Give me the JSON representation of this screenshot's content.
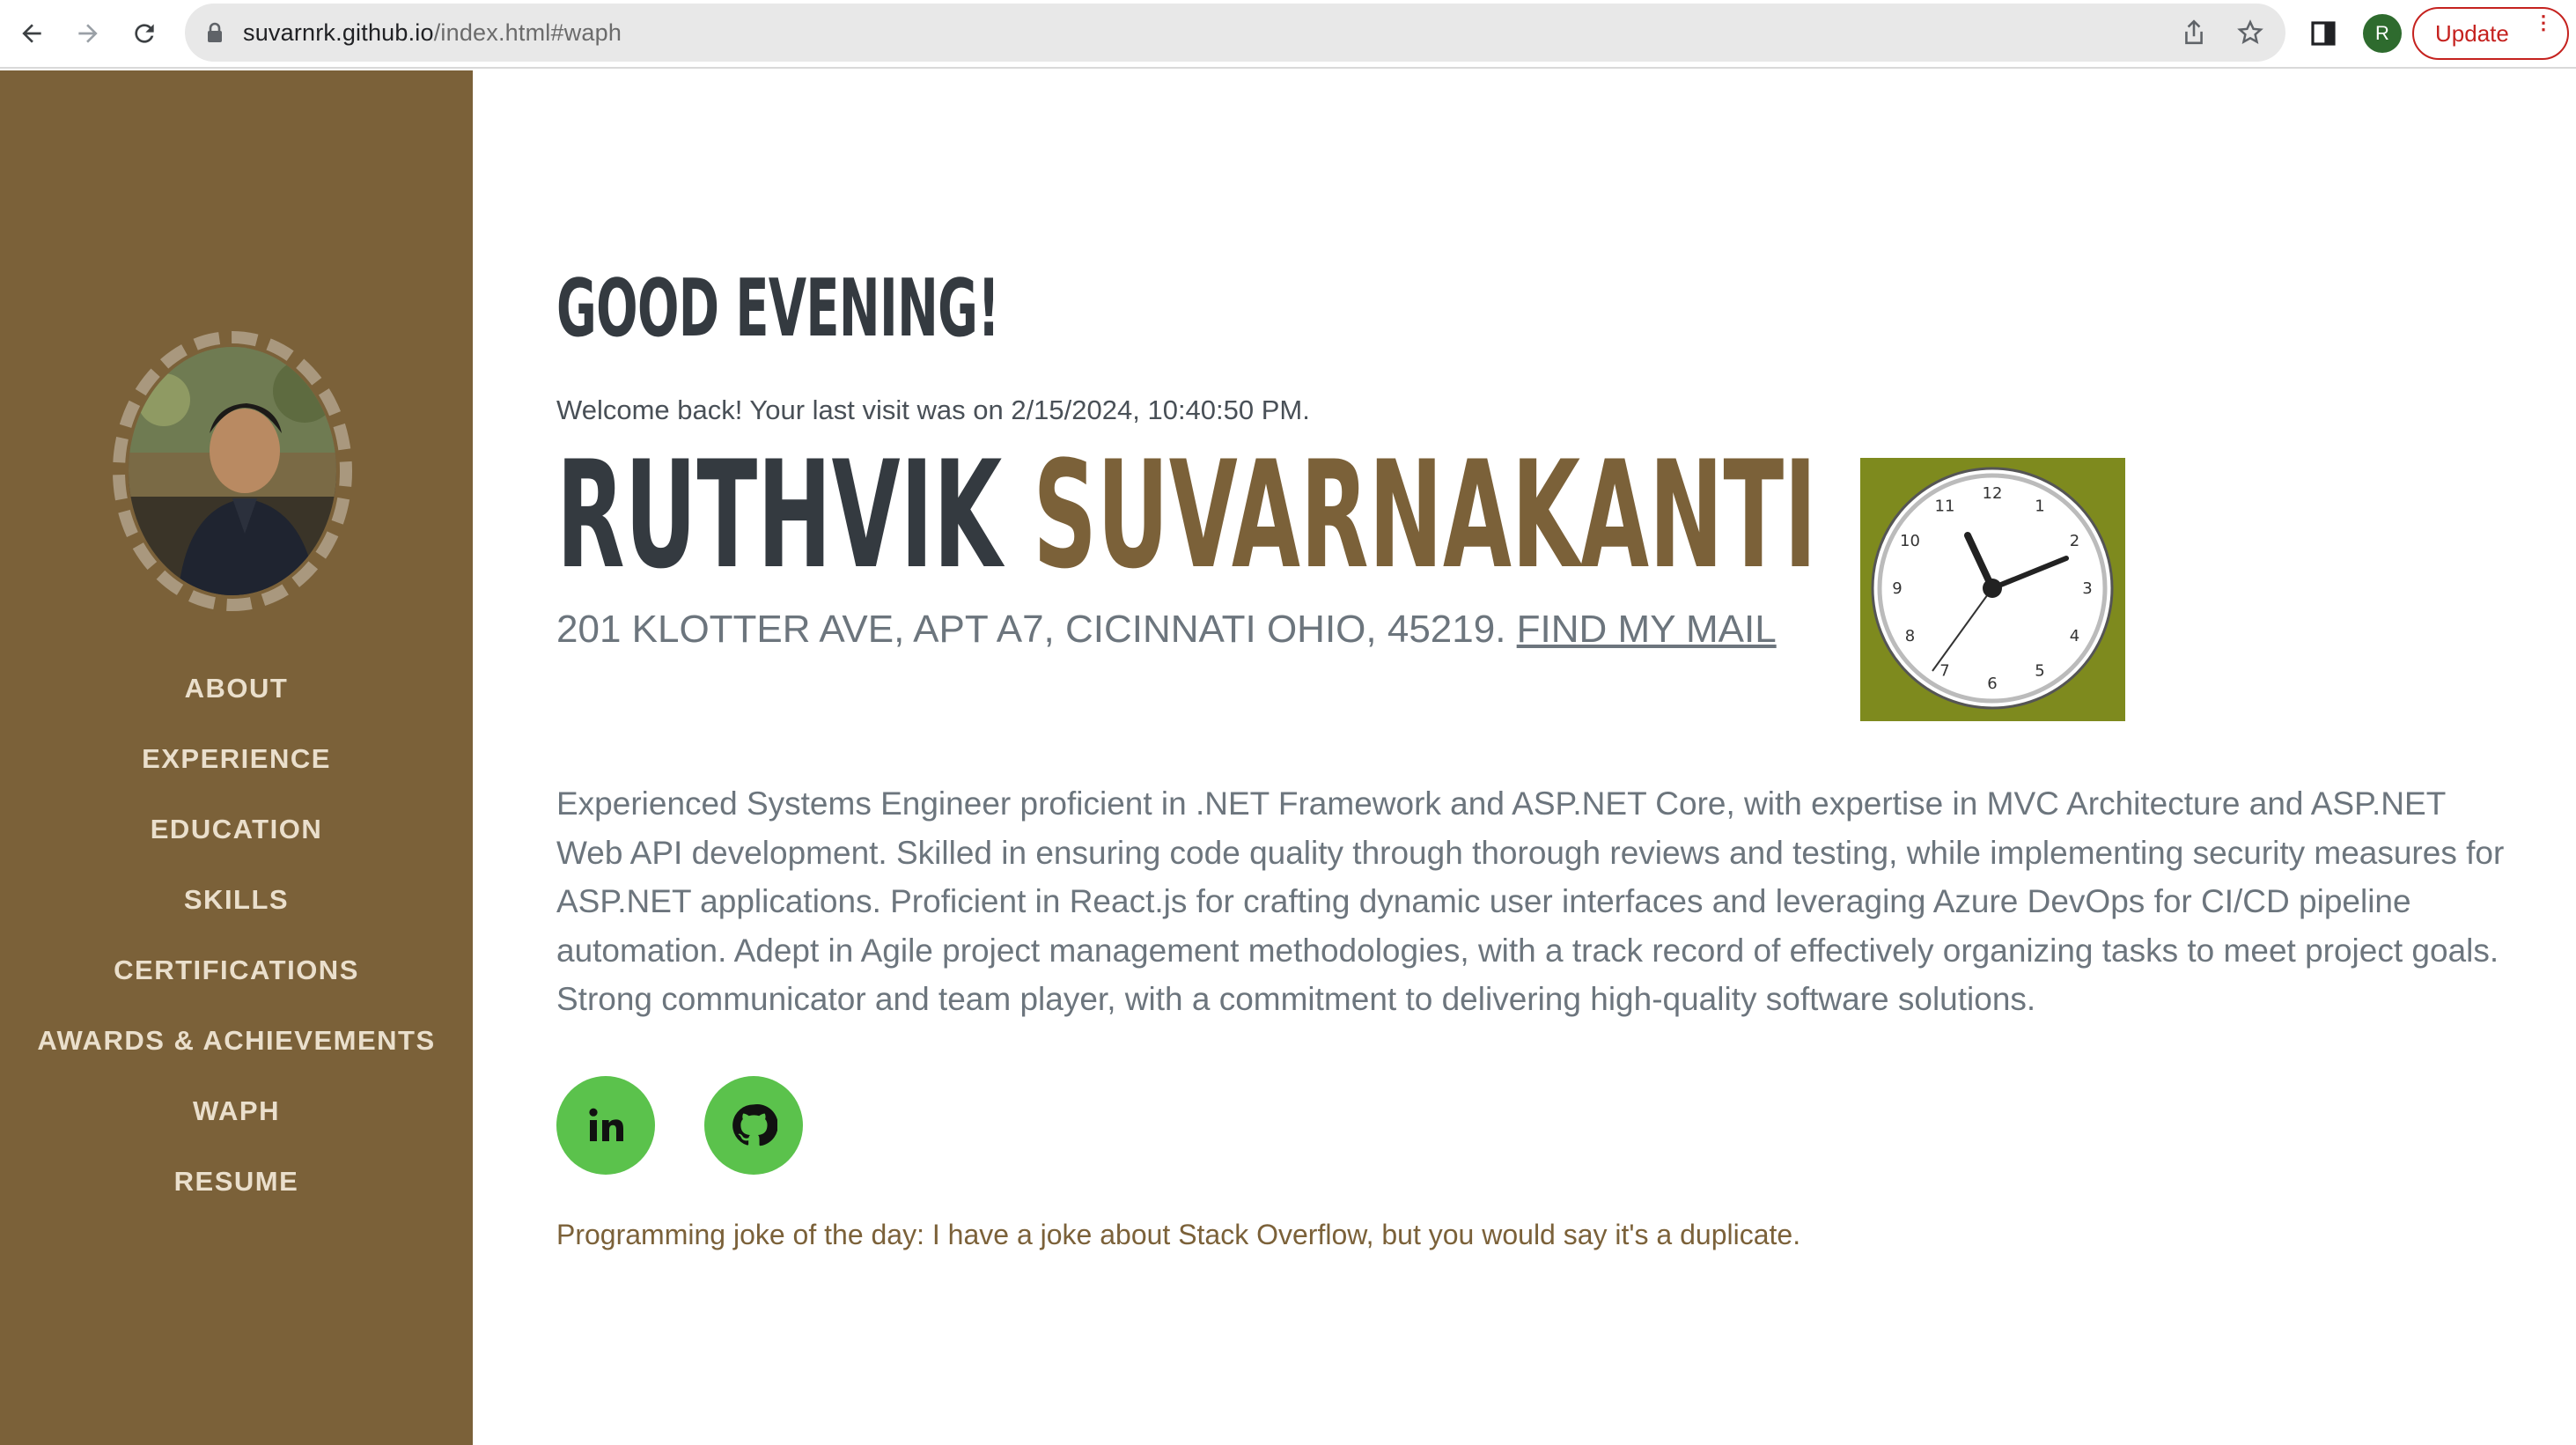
{
  "browser": {
    "url_host": "suvarnrk.github.io",
    "url_path": "/index.html#waph",
    "profile_initial": "R",
    "update_label": "Update",
    "icons": [
      "back-arrow-icon",
      "forward-arrow-icon",
      "reload-icon",
      "lock-icon",
      "share-icon",
      "star-icon",
      "side-panel-icon",
      "menu-dots-icon"
    ]
  },
  "sidebar": {
    "background": "#7b6139",
    "items": [
      {
        "label": "ABOUT"
      },
      {
        "label": "EXPERIENCE"
      },
      {
        "label": "EDUCATION"
      },
      {
        "label": "SKILLS"
      },
      {
        "label": "CERTIFICATIONS"
      },
      {
        "label": "AWARDS & ACHIEVEMENTS"
      },
      {
        "label": "WAPH"
      },
      {
        "label": "RESUME"
      }
    ]
  },
  "main": {
    "greeting": "GOOD EVENING!",
    "last_visit": "Welcome back! Your last visit was on 2/15/2024, 10:40:50 PM.",
    "first_name": "RUTHVIK",
    "last_name": "SUVARNAKANTI",
    "address": "201 KLOTTER AVE, APT A7, CICINNATI OHIO, 45219.",
    "mail_link": "FIND MY MAIL",
    "clock": {
      "numbers": [
        "12",
        "1",
        "2",
        "3",
        "4",
        "5",
        "6",
        "7",
        "8",
        "9",
        "10",
        "11"
      ],
      "background": "#7e8a1e"
    },
    "summary": "Experienced Systems Engineer proficient in .NET Framework and ASP.NET Core, with expertise in MVC Architecture and ASP.NET Web API development. Skilled in ensuring code quality through thorough reviews and testing, while implementing security measures for ASP.NET applications. Proficient in React.js for crafting dynamic user interfaces and leveraging Azure DevOps for CI/CD pipeline automation. Adept in Agile project management methodologies, with a track record of effectively organizing tasks to meet project goals. Strong communicator and team player, with a commitment to delivering high-quality software solutions.",
    "social": [
      {
        "icon": "linkedin-icon"
      },
      {
        "icon": "github-icon"
      }
    ],
    "social_color": "#5bc24c",
    "joke": "Programming joke of the day: I have a joke about Stack Overflow, but you would say it's a duplicate."
  }
}
